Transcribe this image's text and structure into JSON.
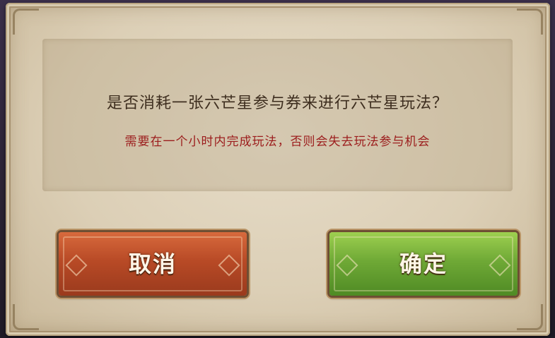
{
  "dialog": {
    "question": "是否消耗一张六芒星参与券来进行六芒星玩法？",
    "warning": "需要在一个小时内完成玩法，否则会失去玩法参与机会"
  },
  "buttons": {
    "cancel_label": "取消",
    "confirm_label": "确定"
  },
  "colors": {
    "question_text": "#3e2e1f",
    "warning_text": "#9c1d1d",
    "cancel_button": "#b84a26",
    "confirm_button": "#6fa936",
    "parchment": "#dccfb6"
  }
}
